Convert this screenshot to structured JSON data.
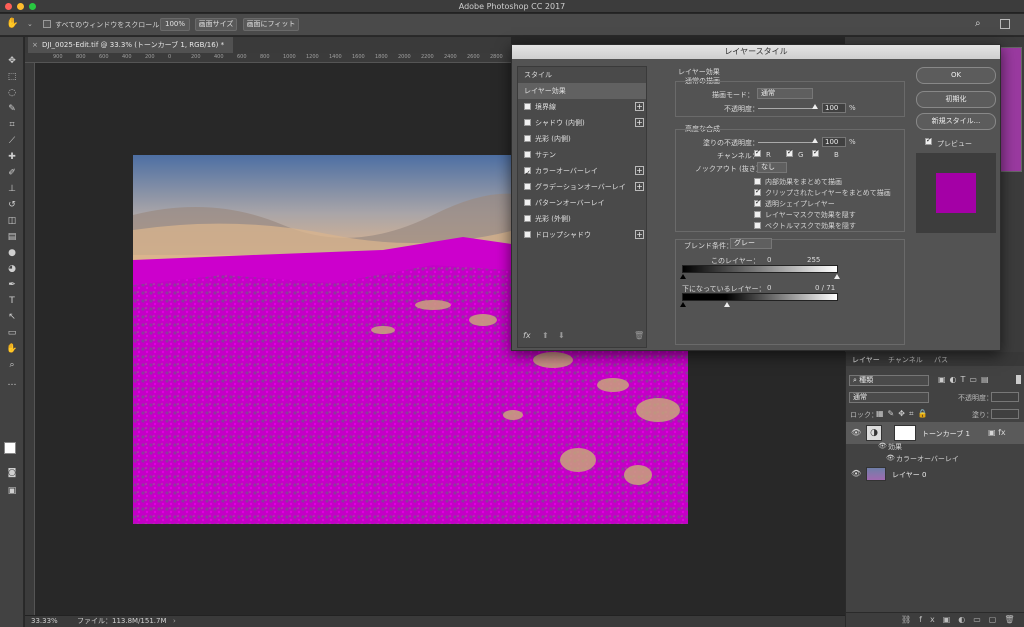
{
  "window": {
    "title": "Adobe Photoshop CC 2017"
  },
  "options": {
    "scroll_all_label": "すべてのウィンドウをスクロール",
    "zoom_100": "100%",
    "screen_size": "画面サイズ",
    "fit_screen": "画面にフィット"
  },
  "document": {
    "tab_title": "DJI_0025-Edit.tif @ 33.3% (トーンカーブ 1, RGB/16) *",
    "ruler_ticks": [
      "900",
      "800",
      "600",
      "400",
      "200",
      "0",
      "200",
      "400",
      "600",
      "800",
      "1000",
      "1200",
      "1400",
      "1600",
      "1800",
      "2000",
      "2200",
      "2400",
      "2600",
      "2800"
    ]
  },
  "status": {
    "zoom": "33.33%",
    "file": "ファイル：113.8M/151.7M"
  },
  "dialog": {
    "title": "レイヤースタイル",
    "styles_header": "スタイル",
    "layer_effects": "レイヤー効果",
    "style_items": [
      {
        "label": "境界線",
        "checked": false,
        "plus": true
      },
      {
        "label": "シャドウ (内側)",
        "checked": false,
        "plus": true
      },
      {
        "label": "光彩 (内側)",
        "checked": false,
        "plus": false
      },
      {
        "label": "サテン",
        "checked": false,
        "plus": false
      },
      {
        "label": "カラーオーバーレイ",
        "checked": true,
        "plus": true
      },
      {
        "label": "グラデーションオーバーレイ",
        "checked": false,
        "plus": true
      },
      {
        "label": "パターンオーバーレイ",
        "checked": false,
        "plus": false
      },
      {
        "label": "光彩 (外側)",
        "checked": false,
        "plus": false
      },
      {
        "label": "ドロップシャドウ",
        "checked": false,
        "plus": true
      }
    ],
    "fx_label": "fx",
    "section_title": "レイヤー効果",
    "general_blend": "通常の描画",
    "blend_mode_label": "描画モード：",
    "blend_mode_value": "通常",
    "opacity_label": "不透明度：",
    "opacity_value": "100",
    "percent": "%",
    "advanced_blend": "高度な合成",
    "fill_opacity_label": "塗りの不透明度：",
    "fill_opacity_value": "100",
    "channels_label": "チャンネル：",
    "ch_r": "R",
    "ch_g": "G",
    "ch_b": "B",
    "knockout_label": "ノックアウト (抜き)：",
    "knockout_value": "なし",
    "options": [
      {
        "label": "内部効果をまとめて描画",
        "checked": false
      },
      {
        "label": "クリップされたレイヤーをまとめて描画",
        "checked": true
      },
      {
        "label": "透明シェイプレイヤー",
        "checked": true
      },
      {
        "label": "レイヤーマスクで効果を隠す",
        "checked": false
      },
      {
        "label": "ベクトルマスクで効果を隠す",
        "checked": false
      }
    ],
    "blend_if_label": "ブレンド条件：",
    "blend_if_value": "グレー",
    "this_layer_label": "このレイヤー：",
    "this_layer_min": "0",
    "this_layer_max": "255",
    "under_layer_label": "下になっているレイヤー：",
    "under_layer_min": "0",
    "under_layer_max": "0 / 71",
    "ok": "OK",
    "reset": "初期化",
    "new_style": "新規スタイル...",
    "preview": "プレビュー",
    "overlay_color": "#a400a6"
  },
  "layers": {
    "tabs": [
      "レイヤー",
      "チャンネル",
      "パス"
    ],
    "kind": "種類",
    "blend": "通常",
    "opacity_label": "不透明度：",
    "lock_label": "ロック：",
    "fill_label": "塗り：",
    "layer1": "トーンカーブ 1",
    "effects": "効果",
    "color_overlay": "カラーオーバーレイ",
    "layer0": "レイヤー 0"
  }
}
